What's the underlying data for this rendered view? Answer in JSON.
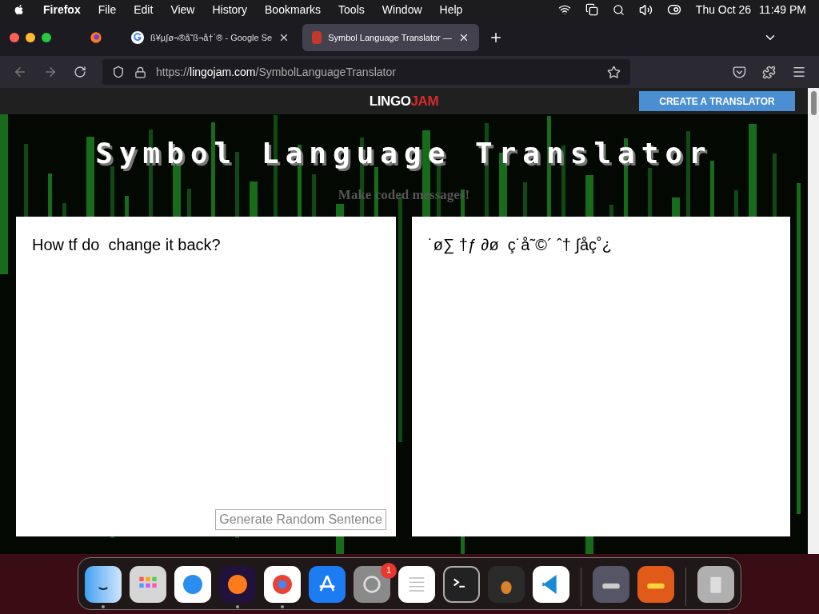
{
  "menu_bar": {
    "app": "Firefox",
    "items": [
      "File",
      "Edit",
      "View",
      "History",
      "Bookmarks",
      "Tools",
      "Window",
      "Help"
    ],
    "date": "Thu Oct 26",
    "time": "11:49 PM"
  },
  "tabs": [
    {
      "title": "ß¥µ∫ø¬®å˜ß¬å†´® - Google Se",
      "selected": false,
      "kind": "google"
    },
    {
      "title": "Symbol Language Translator —",
      "selected": true,
      "kind": "site"
    }
  ],
  "address_bar": {
    "prefix": "https://",
    "domain": "lingojam.com",
    "path": "/SymbolLanguageTranslator"
  },
  "site_header": {
    "logo_left": "LINGO",
    "logo_right": "JAM",
    "button": "CREATE A TRANSLATOR"
  },
  "page": {
    "title": "Symbol Language Translator",
    "subtitle": "Make coded messages!"
  },
  "input": {
    "value": "How tf do  change it back?",
    "button": "Generate Random Sentence"
  },
  "output": {
    "value": "˙ø∑ †ƒ ∂ø  ç˙å˜©´ ˆ† ∫åç˚¿"
  },
  "dock": [
    {
      "kind": "finder",
      "running": true
    },
    {
      "kind": "launchpad",
      "running": false
    },
    {
      "kind": "safari",
      "running": false
    },
    {
      "kind": "firefox",
      "running": true
    },
    {
      "kind": "chrome",
      "running": true
    },
    {
      "kind": "appstore",
      "running": false
    },
    {
      "kind": "settings",
      "running": false,
      "badge": "1"
    },
    {
      "kind": "textedit",
      "running": false
    },
    {
      "kind": "terminal",
      "running": false
    },
    {
      "kind": "garageband",
      "running": false
    },
    {
      "kind": "vscode",
      "running": false
    },
    {
      "kind": "separator"
    },
    {
      "kind": "car",
      "running": false
    },
    {
      "kind": "racing",
      "running": false
    },
    {
      "kind": "separator"
    },
    {
      "kind": "trash",
      "running": false
    }
  ]
}
